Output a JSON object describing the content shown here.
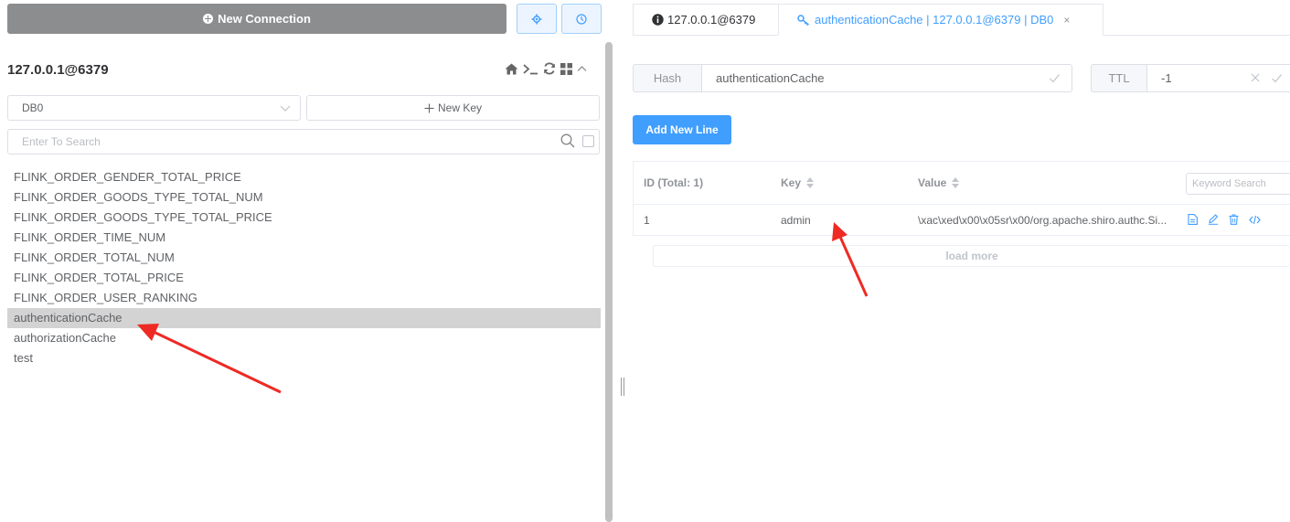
{
  "left": {
    "new_connection_label": "New Connection",
    "connection_name": "127.0.0.1@6379",
    "db_select_value": "DB0",
    "new_key_label": "New Key",
    "search_placeholder": "Enter To Search",
    "keys": [
      "FLINK_ORDER_GENDER_TOTAL_PRICE",
      "FLINK_ORDER_GOODS_TYPE_TOTAL_NUM",
      "FLINK_ORDER_GOODS_TYPE_TOTAL_PRICE",
      "FLINK_ORDER_TIME_NUM",
      "FLINK_ORDER_TOTAL_NUM",
      "FLINK_ORDER_TOTAL_PRICE",
      "FLINK_ORDER_USER_RANKING",
      "authenticationCache",
      "authorizationCache",
      "test"
    ],
    "selected_key": "authenticationCache"
  },
  "tabs": [
    {
      "label": "127.0.0.1@6379",
      "icon": "info-icon"
    },
    {
      "label": "authenticationCache | 127.0.0.1@6379 | DB0",
      "icon": "key-icon",
      "close": "×"
    }
  ],
  "detail": {
    "type_label": "Hash",
    "key_name": "authenticationCache",
    "ttl_label": "TTL",
    "ttl_value": "-1",
    "add_line_label": "Add New Line",
    "table": {
      "col_id": "ID (Total: 1)",
      "col_key": "Key",
      "col_value": "Value",
      "keyword_placeholder": "Keyword Search",
      "rows": [
        {
          "id": "1",
          "key": "admin",
          "value": "\\xac\\xed\\x00\\x05sr\\x00/org.apache.shiro.authc.Si..."
        }
      ]
    },
    "load_more_label": "load more"
  },
  "colors": {
    "primary": "#409eff",
    "annotation_arrow": "#ee2a24",
    "selected_row": "#d3d3d3",
    "new_connection_bg": "#8c8d8f"
  }
}
